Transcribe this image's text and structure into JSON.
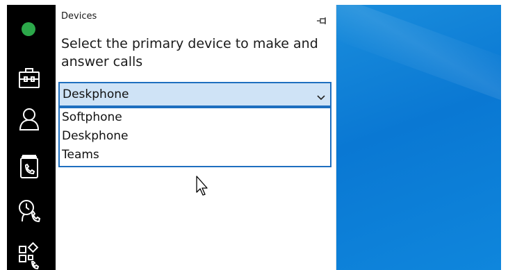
{
  "colors": {
    "status_green": "#2ca84a",
    "sidebar_bg": "#000000",
    "accent_blue": "#1e6fbf",
    "select_bg": "#cfe3f6",
    "desktop_blue": "#0a78d3"
  },
  "sidebar": {
    "status": "online",
    "items": [
      {
        "icon": "briefcase-icon"
      },
      {
        "icon": "person-icon"
      },
      {
        "icon": "phonebook-icon"
      },
      {
        "icon": "call-history-icon"
      },
      {
        "icon": "apps-phone-icon"
      }
    ]
  },
  "panel": {
    "title": "Devices",
    "pin_icon": "pin-icon",
    "prompt": "Select the primary device to make and answer calls",
    "select": {
      "value": "Deskphone",
      "options": [
        "Softphone",
        "Deskphone",
        "Teams"
      ]
    }
  }
}
